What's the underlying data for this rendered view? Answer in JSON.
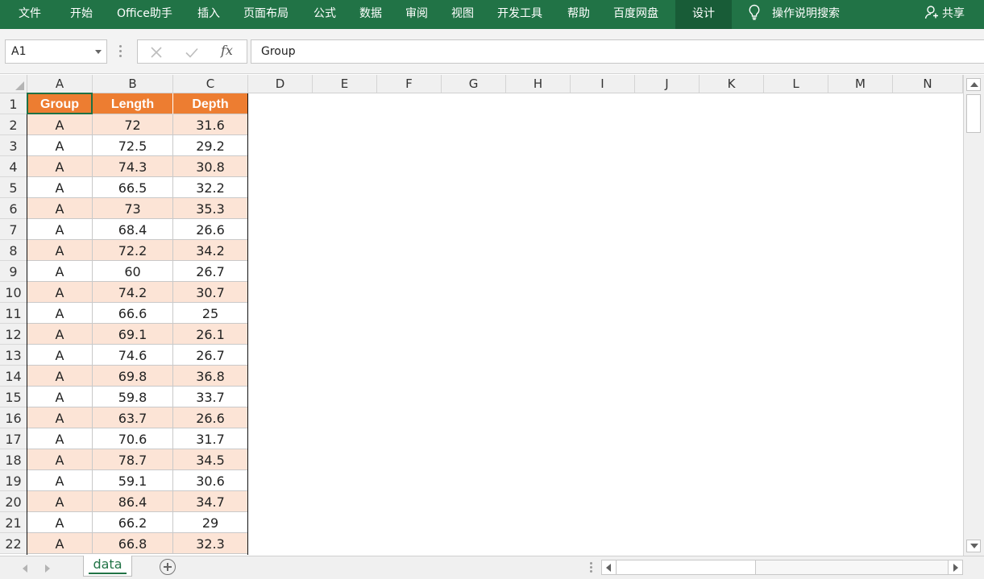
{
  "ribbon": {
    "tabs": [
      "文件",
      "开始",
      "Office助手",
      "插入",
      "页面布局",
      "公式",
      "数据",
      "审阅",
      "视图",
      "开发工具",
      "帮助",
      "百度网盘",
      "设计"
    ],
    "active_tab": "设计",
    "tell_me": "操作说明搜索",
    "share": "共享",
    "colors": {
      "ribbon_bg": "#217346",
      "active_tab_bg": "#185c37"
    }
  },
  "formula_bar": {
    "name_box": "A1",
    "fx_label": "fx",
    "content": "Group"
  },
  "grid": {
    "columns": [
      "A",
      "B",
      "C",
      "D",
      "E",
      "F",
      "G",
      "H",
      "I",
      "J",
      "K",
      "L",
      "M",
      "N"
    ],
    "rows": [
      "1",
      "2",
      "3",
      "4",
      "5",
      "6",
      "7",
      "8",
      "9",
      "10",
      "11",
      "12",
      "13",
      "14",
      "15",
      "16",
      "17",
      "18",
      "19",
      "20",
      "21",
      "22"
    ],
    "table": {
      "headers": [
        "Group",
        "Length",
        "Depth"
      ],
      "data": [
        [
          "A",
          "72",
          "31.6"
        ],
        [
          "A",
          "72.5",
          "29.2"
        ],
        [
          "A",
          "74.3",
          "30.8"
        ],
        [
          "A",
          "66.5",
          "32.2"
        ],
        [
          "A",
          "73",
          "35.3"
        ],
        [
          "A",
          "68.4",
          "26.6"
        ],
        [
          "A",
          "72.2",
          "34.2"
        ],
        [
          "A",
          "60",
          "26.7"
        ],
        [
          "A",
          "74.2",
          "30.7"
        ],
        [
          "A",
          "66.6",
          "25"
        ],
        [
          "A",
          "69.1",
          "26.1"
        ],
        [
          "A",
          "74.6",
          "26.7"
        ],
        [
          "A",
          "69.8",
          "36.8"
        ],
        [
          "A",
          "59.8",
          "33.7"
        ],
        [
          "A",
          "63.7",
          "26.6"
        ],
        [
          "A",
          "70.6",
          "31.7"
        ],
        [
          "A",
          "78.7",
          "34.5"
        ],
        [
          "A",
          "59.1",
          "30.6"
        ],
        [
          "A",
          "86.4",
          "34.7"
        ],
        [
          "A",
          "66.2",
          "29"
        ],
        [
          "A",
          "66.8",
          "32.3"
        ]
      ],
      "colors": {
        "header_bg": "#ed7d31",
        "band_bg": "#fce4d6"
      }
    }
  },
  "sheets": {
    "tabs": [
      "data"
    ],
    "active": "data"
  }
}
